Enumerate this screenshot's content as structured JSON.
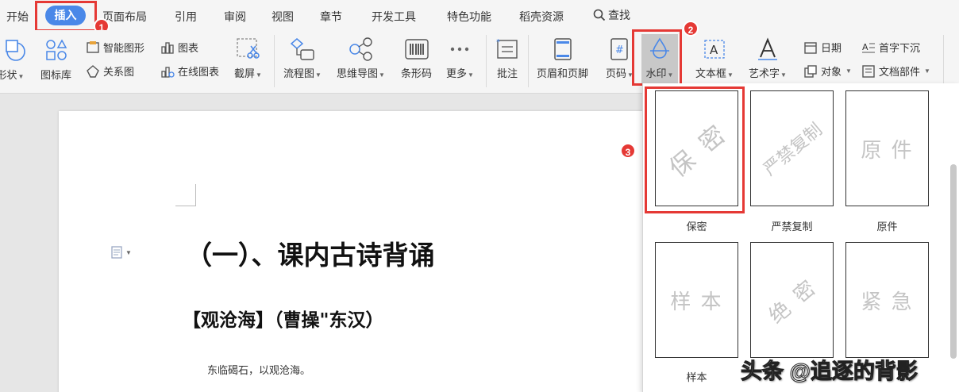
{
  "tabs": {
    "kaishi": "开始",
    "charu": "插入",
    "yemian": "页面布局",
    "yinyong": "引用",
    "shenyue": "审阅",
    "shitu": "视图",
    "zhangjie": "章节",
    "kaifa": "开发工具",
    "tese": "特色功能",
    "daoke": "稻壳资源",
    "search": "查找"
  },
  "ribbon": {
    "shape": "形状",
    "icon_lib": "图标库",
    "smart_art": "智能图形",
    "relation": "关系图",
    "chart": "图表",
    "online_chart": "在线图表",
    "screenshot": "截屏",
    "flowchart": "流程图",
    "mindmap": "思维导图",
    "barcode": "条形码",
    "more": "更多",
    "comment": "批注",
    "header_footer": "页眉和页脚",
    "page_num": "页码",
    "watermark": "水印",
    "textbox": "文本框",
    "wordart": "艺术字",
    "date": "日期",
    "object": "对象",
    "dropcap": "首字下沉",
    "docpart": "文档部件"
  },
  "badges": [
    "1",
    "2",
    "3"
  ],
  "document": {
    "title": "（一）、课内古诗背诵",
    "subtitle": "【观沧海】（曹操\"东汉）",
    "body_line": "东临碣石，以观沧海。"
  },
  "watermarks": [
    {
      "label": "保密",
      "text": "保 密"
    },
    {
      "label": "严禁复制",
      "text": "严禁复制"
    },
    {
      "label": "原件",
      "text": "原 件"
    },
    {
      "label": "样本",
      "text": "样 本"
    },
    {
      "label": "",
      "text": "绝 密"
    },
    {
      "label": "",
      "text": "紧 急"
    }
  ],
  "credit": "头条 @追逐的背影",
  "colors": {
    "accent": "#4a88e8",
    "highlight": "#e53935",
    "watermark_gray": "#c4c4c4"
  }
}
